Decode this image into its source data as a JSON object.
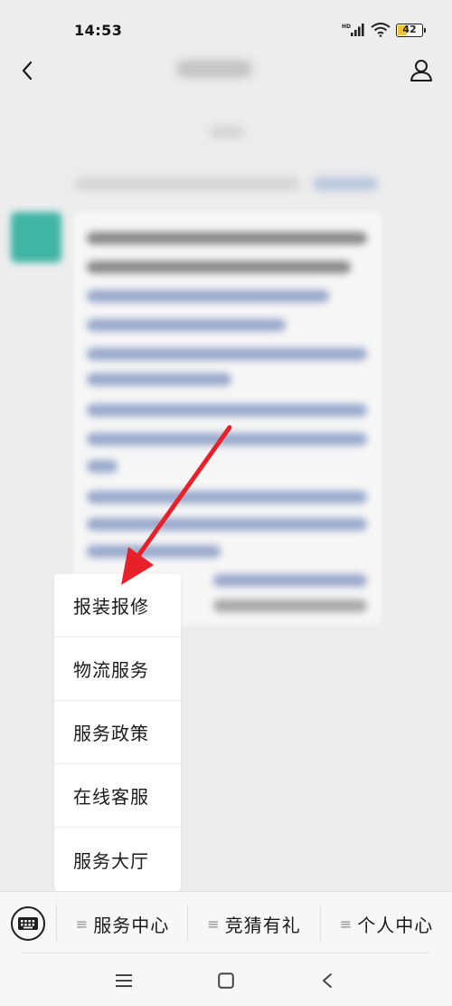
{
  "status_bar": {
    "time": "14:53",
    "network_label": "HD",
    "battery_level": 42,
    "battery_text": "42"
  },
  "nav_bar": {
    "back_icon": "chevron-left-icon",
    "profile_icon": "person-icon",
    "title_blurred": true
  },
  "popup_menu": {
    "items": [
      {
        "label": "报装报修"
      },
      {
        "label": "物流服务"
      },
      {
        "label": "服务政策"
      },
      {
        "label": "在线客服"
      },
      {
        "label": "服务大厅"
      }
    ]
  },
  "bottom_menu": {
    "keyboard_icon": "keyboard-icon",
    "tab_icon_glyph": "≡",
    "tabs": [
      {
        "label": "服务中心"
      },
      {
        "label": "竞猜有礼"
      },
      {
        "label": "个人中心"
      }
    ]
  },
  "system_nav": {
    "menu_icon": "menu-icon",
    "home_icon": "home-square-icon",
    "back_icon": "back-triangle-icon"
  },
  "colors": {
    "background": "#ededed",
    "annotation_arrow": "#e8202a",
    "battery_fill": "#f2c23a",
    "avatar": "#3fb5a3"
  }
}
